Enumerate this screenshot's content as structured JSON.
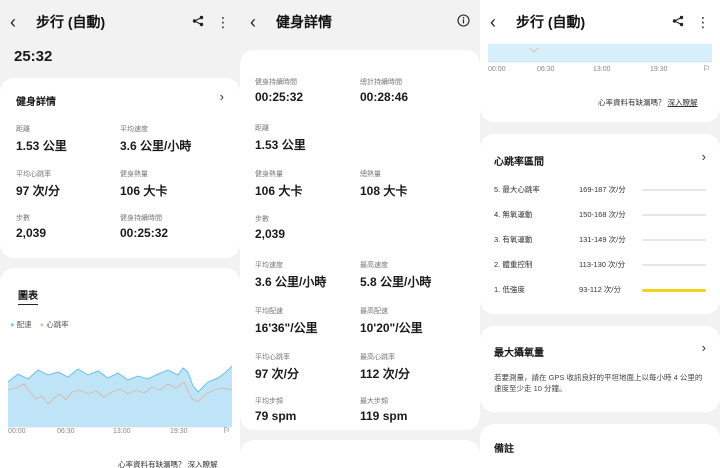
{
  "panel1": {
    "header": {
      "title": "步行 (自動)",
      "back_icon": "chevron-left-icon",
      "share_icon": "share-icon",
      "more_icon": "more-vert-icon"
    },
    "duration_top": "25:32",
    "details": {
      "title": "健身詳情",
      "stats": [
        {
          "label": "距離",
          "value": "1.53 公里"
        },
        {
          "label": "平均速度",
          "value": "3.6 公里/小時"
        },
        {
          "label": "平均心跳率",
          "value": "97 次/分"
        },
        {
          "label": "健身熱量",
          "value": "106 大卡"
        },
        {
          "label": "步數",
          "value": "2,039"
        },
        {
          "label": "健身持續時間",
          "value": "00:25:32"
        }
      ]
    },
    "chart": {
      "title": "圖表",
      "legend": [
        {
          "name": "配速",
          "color": "#7cc8f0"
        },
        {
          "name": "心跳率",
          "color": "#e8c3a8"
        }
      ],
      "x_ticks": [
        "00:00",
        "06:30",
        "13:00",
        "19:30"
      ],
      "missing_text": "心率資料有缺漏嗎？",
      "learn_more": "深入瞭解"
    }
  },
  "panel2": {
    "header": {
      "title": "健身詳情",
      "back_icon": "chevron-left-icon",
      "info_icon": "info-icon"
    },
    "stats": [
      {
        "label": "健身持續時間",
        "value": "00:25:32"
      },
      {
        "label": "總計持續時間",
        "value": "00:28:46"
      },
      {
        "label": "距離",
        "value": "1.53 公里"
      },
      {
        "label": "健身熱量",
        "value": "106 大卡"
      },
      {
        "label": "總熱量",
        "value": "108 大卡"
      },
      {
        "label": "步數",
        "value": "2,039"
      },
      {
        "label": "平均速度",
        "value": "3.6 公里/小時"
      },
      {
        "label": "最高速度",
        "value": "5.8 公里/小時"
      },
      {
        "label": "平均配速",
        "value": "16'36\"/公里"
      },
      {
        "label": "最高配速",
        "value": "10'20\"/公里"
      },
      {
        "label": "平均心跳率",
        "value": "97 次/分"
      },
      {
        "label": "最高心跳率",
        "value": "112 次/分"
      },
      {
        "label": "平均步頻",
        "value": "79 spm"
      },
      {
        "label": "最大步頻",
        "value": "119 spm"
      }
    ]
  },
  "panel3": {
    "header": {
      "title": "步行 (自動)",
      "back_icon": "chevron-left-icon",
      "share_icon": "share-icon",
      "more_icon": "more-vert-icon"
    },
    "x_ticks": [
      "00:00",
      "06:30",
      "13:00",
      "19:30"
    ],
    "missing_text": "心率資料有缺漏嗎？",
    "learn_more": "深入瞭解",
    "hr_zones": {
      "title": "心跳率區間",
      "zones": [
        {
          "name": "5. 最大心跳率",
          "range": "169-187 次/分",
          "fraction": 0
        },
        {
          "name": "4. 無氧運動",
          "range": "150-168 次/分",
          "fraction": 0
        },
        {
          "name": "3. 有氧運動",
          "range": "131-149 次/分",
          "fraction": 0
        },
        {
          "name": "2. 體重控制",
          "range": "113-130 次/分",
          "fraction": 0
        },
        {
          "name": "1. 低強度",
          "range": "93-112 次/分",
          "fraction": 1
        }
      ]
    },
    "vo2": {
      "title": "最大攝氧量",
      "desc": "若要測量，請在 GPS 收訊良好的平坦地面上以每小時 4 公里的速度至少走 10 分鐘。"
    },
    "notes": {
      "title": "備註"
    }
  }
}
